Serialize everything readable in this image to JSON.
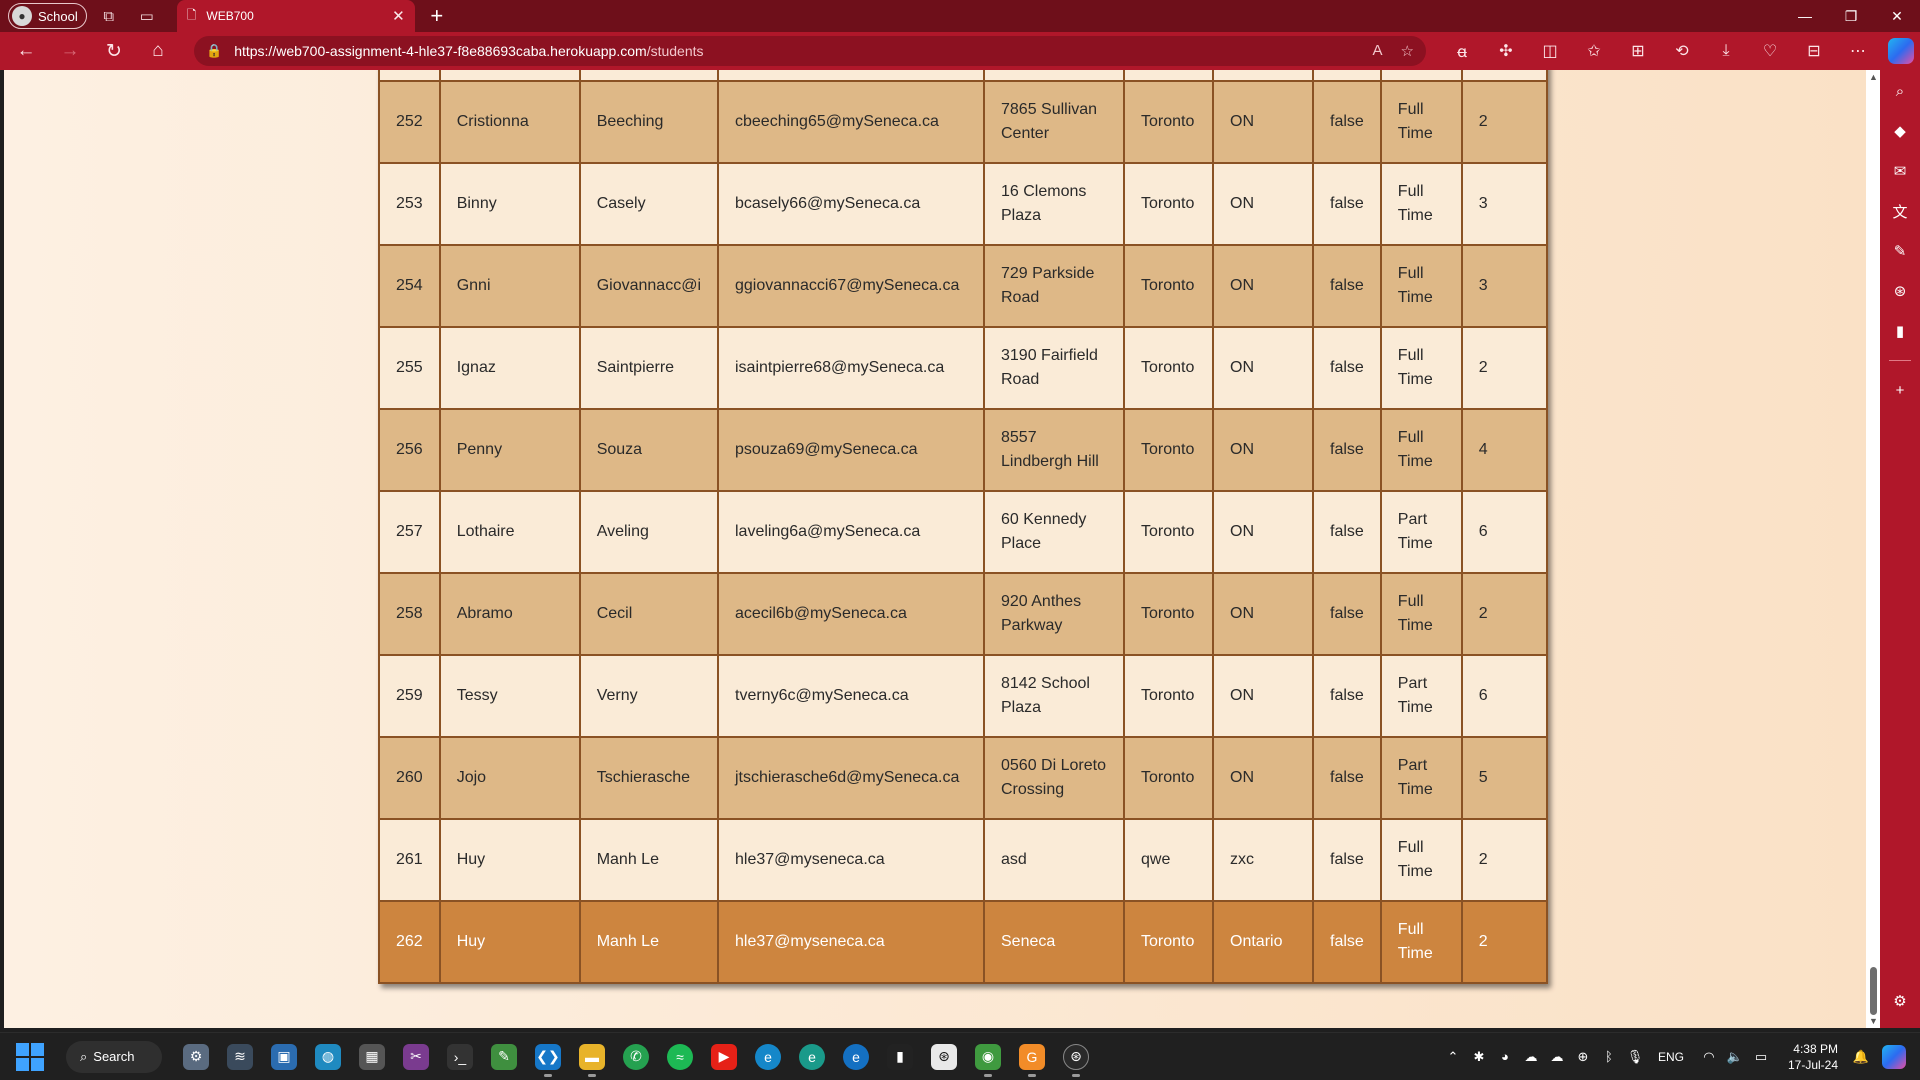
{
  "browser": {
    "profile_label": "School",
    "tab_title": "WEB700",
    "url_host": "https://web700-assignment-4-hle37-f8e88693caba.herokuapp.com",
    "url_path": "/students"
  },
  "students": [
    {
      "num": "252",
      "first": "Cristionna",
      "last": "Beeching",
      "email": "cbeeching65@mySeneca.ca",
      "address": "7865 Sullivan Center",
      "city": "Toronto",
      "province": "ON",
      "ta": "false",
      "status": "Full Time",
      "course": "2"
    },
    {
      "num": "253",
      "first": "Binny",
      "last": "Casely",
      "email": "bcasely66@mySeneca.ca",
      "address": "16 Clemons Plaza",
      "city": "Toronto",
      "province": "ON",
      "ta": "false",
      "status": "Full Time",
      "course": "3"
    },
    {
      "num": "254",
      "first": "Gnni",
      "last": "Giovannacc@i",
      "email": "ggiovannacci67@mySeneca.ca",
      "address": "729 Parkside Road",
      "city": "Toronto",
      "province": "ON",
      "ta": "false",
      "status": "Full Time",
      "course": "3"
    },
    {
      "num": "255",
      "first": "Ignaz",
      "last": "Saintpierre",
      "email": "isaintpierre68@mySeneca.ca",
      "address": "3190 Fairfield Road",
      "city": "Toronto",
      "province": "ON",
      "ta": "false",
      "status": "Full Time",
      "course": "2"
    },
    {
      "num": "256",
      "first": "Penny",
      "last": "Souza",
      "email": "psouza69@mySeneca.ca",
      "address": "8557 Lindbergh Hill",
      "city": "Toronto",
      "province": "ON",
      "ta": "false",
      "status": "Full Time",
      "course": "4"
    },
    {
      "num": "257",
      "first": "Lothaire",
      "last": "Aveling",
      "email": "laveling6a@mySeneca.ca",
      "address": "60 Kennedy Place",
      "city": "Toronto",
      "province": "ON",
      "ta": "false",
      "status": "Part Time",
      "course": "6"
    },
    {
      "num": "258",
      "first": "Abramo",
      "last": "Cecil",
      "email": "acecil6b@mySeneca.ca",
      "address": "920 Anthes Parkway",
      "city": "Toronto",
      "province": "ON",
      "ta": "false",
      "status": "Full Time",
      "course": "2"
    },
    {
      "num": "259",
      "first": "Tessy",
      "last": "Verny",
      "email": "tverny6c@mySeneca.ca",
      "address": "8142 School Plaza",
      "city": "Toronto",
      "province": "ON",
      "ta": "false",
      "status": "Part Time",
      "course": "6"
    },
    {
      "num": "260",
      "first": "Jojo",
      "last": "Tschierasche",
      "email": "jtschierasche6d@mySeneca.ca",
      "address": "0560 Di Loreto Crossing",
      "city": "Toronto",
      "province": "ON",
      "ta": "false",
      "status": "Part Time",
      "course": "5"
    },
    {
      "num": "261",
      "first": "Huy",
      "last": "Manh Le",
      "email": "hle37@myseneca.ca",
      "address": "asd",
      "city": "qwe",
      "province": "zxc",
      "ta": "false",
      "status": "Full Time",
      "course": "2"
    },
    {
      "num": "262",
      "first": "Huy",
      "last": "Manh Le",
      "email": "hle37@myseneca.ca",
      "address": "Seneca",
      "city": "Toronto",
      "province": "Ontario",
      "ta": "false",
      "status": "Full Time",
      "course": "2"
    }
  ],
  "taskbar": {
    "search_label": "Search",
    "lang": "ENG",
    "time": "4:38 PM",
    "date": "17-Jul-24"
  },
  "colors": {
    "row_odd": "#deb887",
    "row_even": "#faebd7",
    "row_highlight": "#cd853f",
    "table_border": "#8a5224",
    "browser_accent": "#b0172a"
  }
}
